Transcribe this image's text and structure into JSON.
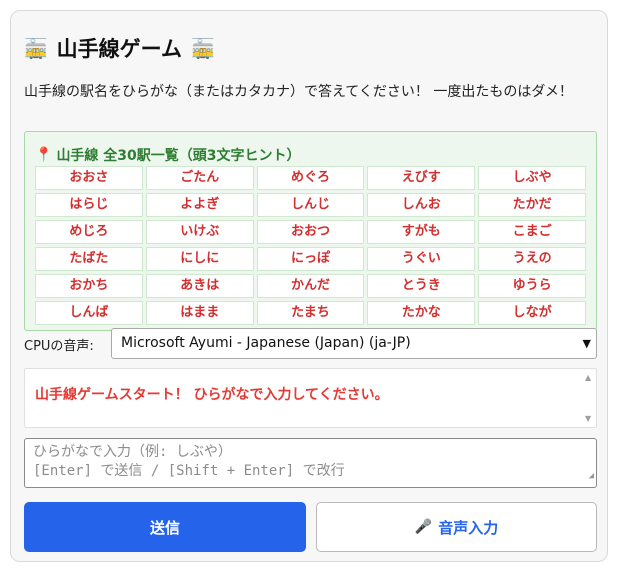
{
  "header": {
    "title": "山手線ゲーム",
    "left_icon": "train-icon",
    "right_icon": "train-icon"
  },
  "description": "山手線の駅名をひらがな（またはカタカナ）で答えてください！ 一度出たものはダメ！",
  "hint": {
    "icon": "pin-icon",
    "title": "山手線 全30駅一覧（頭3文字ヒント）",
    "stations": [
      [
        "おおさ",
        "ごたん",
        "めぐろ",
        "えびす",
        "しぶや"
      ],
      [
        "はらじ",
        "よよぎ",
        "しんじ",
        "しんお",
        "たかだ"
      ],
      [
        "めじろ",
        "いけぶ",
        "おおつ",
        "すがも",
        "こまご"
      ],
      [
        "たばた",
        "にしに",
        "にっぽ",
        "うぐい",
        "うえの"
      ],
      [
        "おかち",
        "あきは",
        "かんだ",
        "とうき",
        "ゆうら"
      ],
      [
        "しんば",
        "はまま",
        "たまち",
        "たかな",
        "しなが"
      ]
    ]
  },
  "voice": {
    "label": "CPUの音声:",
    "selected": "Microsoft Ayumi - Japanese (Japan) (ja-JP)"
  },
  "log": {
    "message": "山手線ゲームスタート！ ひらがなで入力してください。"
  },
  "input": {
    "placeholder": "ひらがなで入力（例: しぶや）\n[Enter] で送信 / [Shift + Enter] で改行"
  },
  "buttons": {
    "send": "送信",
    "voice_input": "音声入力"
  },
  "colors": {
    "accent": "#2563eb",
    "station_text": "#d32f2f",
    "hint_title": "#2e7d32",
    "log_text": "#e53935"
  }
}
